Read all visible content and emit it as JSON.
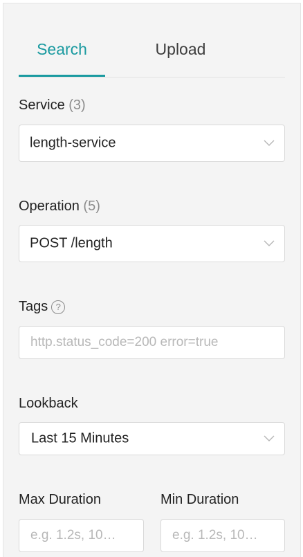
{
  "tabs": {
    "search": "Search",
    "upload": "Upload"
  },
  "service": {
    "label": "Service",
    "count": "(3)",
    "value": "length-service"
  },
  "operation": {
    "label": "Operation",
    "count": "(5)",
    "value": "POST /length"
  },
  "tags": {
    "label": "Tags",
    "help": "?",
    "placeholder": "http.status_code=200 error=true"
  },
  "lookback": {
    "label": "Lookback",
    "value": "Last 15 Minutes"
  },
  "max_duration": {
    "label": "Max Duration",
    "placeholder": "e.g. 1.2s, 10…"
  },
  "min_duration": {
    "label": "Min Duration",
    "placeholder": "e.g. 1.2s, 10…"
  },
  "colors": {
    "accent": "#1a9aa0",
    "panel_bg": "#f4f4f4",
    "border": "#d9d9d9",
    "muted": "#8c8c8c"
  },
  "icons": {
    "select_chevron": "chevron-down-icon",
    "tags_help": "question-circle-icon"
  }
}
